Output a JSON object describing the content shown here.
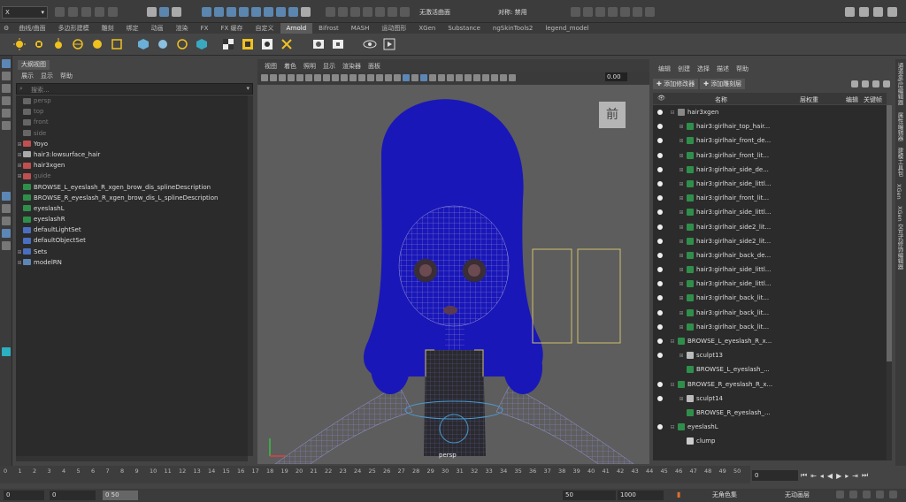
{
  "toolbar": {
    "mode": "X",
    "xgen_curve": "无激活曲面",
    "symmetry": "对称: 禁用"
  },
  "shelf_tabs": [
    "曲线/曲面",
    "多边形建模",
    "雕刻",
    "绑定",
    "动画",
    "渲染",
    "FX",
    "FX 缓存",
    "自定义",
    "Arnold",
    "Bifrost",
    "MASH",
    "运动图形",
    "XGen",
    "Substance",
    "ngSkinTools2",
    "legend_model"
  ],
  "shelf_active": "Arnold",
  "outliner": {
    "title": "大纲视图",
    "menu": [
      "展示",
      "显示",
      "帮助"
    ],
    "search_placeholder": "搜索...",
    "items": [
      {
        "label": "persp",
        "dim": true,
        "icon": "camera-icon",
        "expand": ""
      },
      {
        "label": "top",
        "dim": true,
        "icon": "camera-icon",
        "expand": ""
      },
      {
        "label": "front",
        "dim": true,
        "icon": "camera-icon",
        "expand": ""
      },
      {
        "label": "side",
        "dim": true,
        "icon": "camera-icon",
        "expand": ""
      },
      {
        "label": "Yoyo",
        "dim": false,
        "icon": "curve-icon",
        "expand": "⊞"
      },
      {
        "label": "hair3:lowsurface_hair",
        "dim": false,
        "icon": "mesh-icon",
        "expand": "⊞"
      },
      {
        "label": "hair3xgen",
        "dim": false,
        "icon": "curve-icon",
        "expand": "⊞"
      },
      {
        "label": "guide",
        "dim": true,
        "icon": "curve-icon",
        "expand": "⊞"
      },
      {
        "label": "BROWSE_L_eyeslash_R_xgen_brow_dis_splineDescription",
        "dim": false,
        "icon": "xgen-icon",
        "expand": ""
      },
      {
        "label": "BROWSE_R_eyeslash_R_xgen_brow_dis_L_splineDescription",
        "dim": false,
        "icon": "xgen-icon",
        "expand": ""
      },
      {
        "label": "eyeslashL",
        "dim": false,
        "icon": "xgen-icon",
        "expand": ""
      },
      {
        "label": "eyeslashR",
        "dim": false,
        "icon": "xgen-icon",
        "expand": ""
      },
      {
        "label": "defaultLightSet",
        "dim": false,
        "icon": "set-icon",
        "expand": ""
      },
      {
        "label": "defaultObjectSet",
        "dim": false,
        "icon": "set-icon",
        "expand": ""
      },
      {
        "label": "Sets",
        "dim": false,
        "icon": "set-icon",
        "expand": "⊞"
      },
      {
        "label": "modelRN",
        "dim": false,
        "icon": "reference-icon",
        "expand": "⊞"
      }
    ]
  },
  "viewport": {
    "menu": [
      "视图",
      "着色",
      "照明",
      "显示",
      "渲染器",
      "面板"
    ],
    "field_value": "0.00",
    "view_cube_label": "前",
    "camera_label": "persp"
  },
  "rightpanel": {
    "menu": [
      "编辑",
      "创建",
      "选择",
      "描述",
      "帮助"
    ],
    "btn_add_modifier": "添加修改器",
    "btn_add_sculpt": "添加雕刻层",
    "col_name": "名称",
    "col_weight": "层权重",
    "col_edit": "编辑",
    "col_keyframe": "关键帧",
    "rows": [
      {
        "label": "hair3xgen",
        "dot": true,
        "indent": 0,
        "icon": "folder-icon",
        "expand": "⊟"
      },
      {
        "label": "hair3:girlhair_top_hair...",
        "dot": true,
        "indent": 1,
        "icon": "xgen-icon",
        "expand": "⊞"
      },
      {
        "label": "hair3:girlhair_front_de...",
        "dot": true,
        "indent": 1,
        "icon": "xgen-icon",
        "expand": "⊞"
      },
      {
        "label": "hair3:girlhair_front_lit...",
        "dot": true,
        "indent": 1,
        "icon": "xgen-icon",
        "expand": "⊞"
      },
      {
        "label": "hair3:girlhair_side_de...",
        "dot": true,
        "indent": 1,
        "icon": "xgen-icon",
        "expand": "⊞"
      },
      {
        "label": "hair3:girlhair_side_littl...",
        "dot": true,
        "indent": 1,
        "icon": "xgen-icon",
        "expand": "⊞"
      },
      {
        "label": "hair3:girlhair_front_lit...",
        "dot": true,
        "indent": 1,
        "icon": "xgen-icon",
        "expand": "⊞"
      },
      {
        "label": "hair3:girlhair_side_littl...",
        "dot": true,
        "indent": 1,
        "icon": "xgen-icon",
        "expand": "⊞"
      },
      {
        "label": "hair3:girlhair_side2_lit...",
        "dot": true,
        "indent": 1,
        "icon": "xgen-icon",
        "expand": "⊞"
      },
      {
        "label": "hair3:girlhair_side2_lit...",
        "dot": true,
        "indent": 1,
        "icon": "xgen-icon",
        "expand": "⊞"
      },
      {
        "label": "hair3:girlhair_back_de...",
        "dot": true,
        "indent": 1,
        "icon": "xgen-icon",
        "expand": "⊞"
      },
      {
        "label": "hair3:girlhair_side_littl...",
        "dot": true,
        "indent": 1,
        "icon": "xgen-icon",
        "expand": "⊞"
      },
      {
        "label": "hair3:girlhair_side_littl...",
        "dot": true,
        "indent": 1,
        "icon": "xgen-icon",
        "expand": "⊞"
      },
      {
        "label": "hair3:girlhair_back_lit...",
        "dot": true,
        "indent": 1,
        "icon": "xgen-icon",
        "expand": "⊞"
      },
      {
        "label": "hair3:girlhair_back_lit...",
        "dot": true,
        "indent": 1,
        "icon": "xgen-icon",
        "expand": "⊞"
      },
      {
        "label": "hair3:girlhair_back_lit...",
        "dot": true,
        "indent": 1,
        "icon": "xgen-icon",
        "expand": "⊞"
      },
      {
        "label": "BROWSE_L_eyeslash_R_x...",
        "dot": true,
        "indent": 0,
        "icon": "xgen-icon",
        "expand": "⊟"
      },
      {
        "label": "sculpt13",
        "dot": true,
        "indent": 1,
        "icon": "sculpt-icon",
        "expand": "⊞"
      },
      {
        "label": "BROWSE_L_eyeslash_...",
        "dot": false,
        "indent": 1,
        "icon": "grid-icon",
        "expand": ""
      },
      {
        "label": "BROWSE_R_eyeslash_R_x...",
        "dot": true,
        "indent": 0,
        "icon": "xgen-icon",
        "expand": "⊟"
      },
      {
        "label": "sculpt14",
        "dot": true,
        "indent": 1,
        "icon": "sculpt-icon",
        "expand": "⊞"
      },
      {
        "label": "BROWSE_R_eyeslash_...",
        "dot": false,
        "indent": 1,
        "icon": "grid-icon",
        "expand": ""
      },
      {
        "label": "eyeslashL",
        "dot": true,
        "indent": 0,
        "icon": "xgen-icon",
        "expand": "⊟"
      },
      {
        "label": "clump",
        "dot": false,
        "indent": 1,
        "icon": "clump-icon",
        "expand": ""
      }
    ]
  },
  "vtabs": [
    "通道盒/层编辑器",
    "属性编辑器",
    "建模工具包",
    "XGen",
    "XGen 交互式修饰编辑器"
  ],
  "timeline": {
    "ticks": [
      "0",
      "1",
      "2",
      "3",
      "4",
      "5",
      "6",
      "7",
      "8",
      "9",
      "10",
      "11",
      "12",
      "13",
      "14",
      "15",
      "16",
      "17",
      "18",
      "19",
      "20",
      "21",
      "22",
      "23",
      "24",
      "25",
      "26",
      "27",
      "28",
      "29",
      "30",
      "31",
      "32",
      "33",
      "34",
      "35",
      "36",
      "37",
      "38",
      "39",
      "40",
      "41",
      "42",
      "43",
      "44",
      "45",
      "46",
      "47",
      "48",
      "49",
      "50"
    ],
    "current_frame": "0"
  },
  "range": {
    "start": "0",
    "inner_start": "0",
    "slider_label": "0 50",
    "inner_end": "50",
    "end": "1000",
    "charset": "无角色集",
    "anim_layer": "无动画层"
  },
  "colors": {
    "hair": "#1a17b8",
    "mesh_wire": "#7f7fd1",
    "accent_blue": "#5b86b5",
    "xgen_green": "#2f8f4a"
  }
}
